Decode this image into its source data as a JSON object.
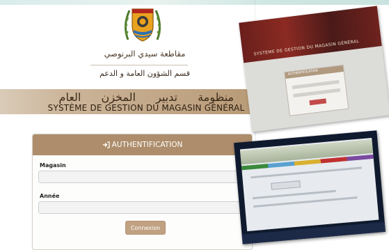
{
  "header": {
    "arabic_title": "مقاطعة سيدي البرنوصي",
    "arabic_subtitle": "قسم الشؤون العامة و الدعم",
    "banner_arabic": "منظومة تدبير المخزن العام",
    "banner_french": "SYSTÈME DE GESTION DU MAGASIN GÉNÉRAL"
  },
  "auth_panel": {
    "title": "AUTHENTIFICATION",
    "title_icon": "sign-in-icon",
    "magasin_label": "Magasin",
    "magasin_value": "",
    "annee_label": "Année",
    "annee_value": "",
    "submit_label": "Connexion"
  },
  "inset_photos": {
    "photo1_title": "SYSTÈME DE GESTION DU MAGASIN GÉNÉRAL",
    "photo1_card_title": "AUTHENTIFICATION"
  },
  "colors": {
    "accent_brown": "#ad8d6b",
    "button_brown": "#c0a282",
    "banner_brown": "#b89a76"
  }
}
